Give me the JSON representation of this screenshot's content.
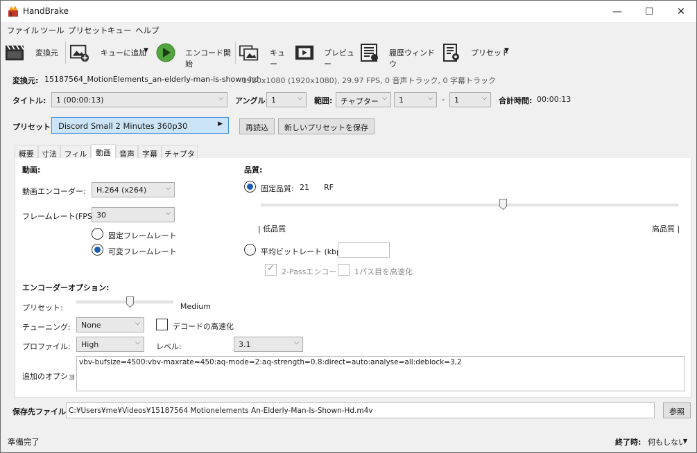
{
  "window": {
    "title": "HandBrake",
    "controls": {
      "minimize": "—",
      "maximize": "☐",
      "close": "✕"
    }
  },
  "menu": [
    "ファイル",
    "ツール",
    "プリセット",
    "キュー",
    "ヘルプ"
  ],
  "toolbar": {
    "source": "変換元",
    "add_to_queue": "キューに追加",
    "start_encode": "エンコード開始",
    "queue": "キュー",
    "preview": "プレビュー",
    "activity": "履歴ウィンドウ",
    "presets": "プリセット"
  },
  "source": {
    "label": "変換元:",
    "name": "15187564_MotionElements_an-elderly-man-is-shown-hd",
    "info": "1920x1080 (1920x1080), 29.97 FPS, 0 音声トラック, 0 字幕トラック"
  },
  "title_row": {
    "title_label": "タイトル:",
    "title_value": "1 (00:00:13)",
    "angle_label": "アングル:",
    "angle_value": "1",
    "range_label": "範囲:",
    "range_value": "チャプター",
    "range_start": "1",
    "dash": "-",
    "range_end": "1",
    "duration_label": "合計時間:",
    "duration_value": "00:00:13"
  },
  "preset_row": {
    "label": "プリセット:",
    "value": "Discord Small 2 Minutes 360p30",
    "reload": "再読込",
    "save_new": "新しいプリセットを保存"
  },
  "tabs": [
    "概要",
    "寸法",
    "フィルタ",
    "動画",
    "音声",
    "字幕",
    "チャプター"
  ],
  "video": {
    "section": "動画:",
    "encoder_label": "動画エンコーダー:",
    "encoder_value": "H.264 (x264)",
    "framerate_label": "フレームレート(FPS):",
    "framerate_value": "30",
    "cfr": "固定フレームレート",
    "vfr": "可変フレームレート"
  },
  "quality": {
    "section": "品質:",
    "constant_label": "固定品質:",
    "rf_value": "21",
    "rf_unit": "RF",
    "slider_level": 0.58,
    "low": "| 低品質",
    "high": "高品質 |",
    "avg_bitrate_label": "平均ビットレート (kbps):",
    "avg_bitrate_value": "",
    "two_pass": "2-Passエンコード",
    "turbo": "1パス目を高速化"
  },
  "encoder_options": {
    "section": "エンコーダーオプション:",
    "preset_label": "プリセット:",
    "preset_value": "Medium",
    "preset_level": 0.55,
    "tune_label": "チューニング:",
    "tune_value": "None",
    "fast_decode": "デコードの高速化",
    "profile_label": "プロファイル:",
    "profile_value": "High",
    "level_label": "レベル:",
    "level_value": "3.1",
    "extra_label": "追加のオプション:",
    "extra_value": "vbv-bufsize=4500:vbv-maxrate=450:aq-mode=2:aq-strength=0.8:direct=auto:analyse=all:deblock=3,2"
  },
  "destination": {
    "label": "保存先ファイル:",
    "path": "C:¥Users¥me¥Videos¥15187564 Motionelements An-Elderly-Man-Is-Shown-Hd.m4v",
    "browse": "参照"
  },
  "status": {
    "text": "準備完了",
    "when_done_label": "終了時:",
    "when_done_value": "何もしない"
  }
}
